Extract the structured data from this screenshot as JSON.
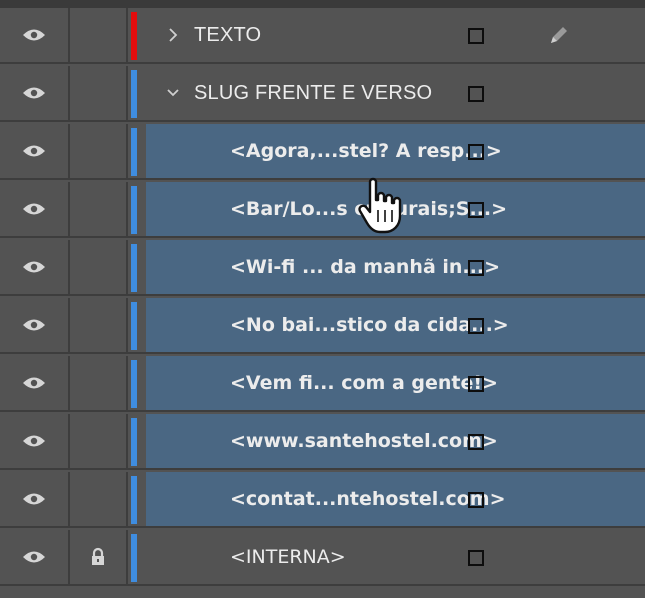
{
  "colors": {
    "panel_bg": "#535353",
    "selected_bg": "#4a6783",
    "layer_color_red": "#e20d0d",
    "layer_color_blue": "#3f8de0",
    "text": "#ececec"
  },
  "layers_panel": {
    "rows": [
      {
        "label": "TEXTO",
        "kind": "layer",
        "expander": "collapsed",
        "visible": true,
        "locked": false,
        "color": "red",
        "selected": false,
        "has_pen": true
      },
      {
        "label": "SLUG FRENTE E VERSO",
        "kind": "layer",
        "expander": "expanded",
        "visible": true,
        "locked": false,
        "color": "blue",
        "selected": false,
        "has_pen": false
      },
      {
        "label": "<Agora,...stel? A resp...>",
        "kind": "item",
        "visible": true,
        "locked": false,
        "color": "blue",
        "selected": true
      },
      {
        "label": "<Bar/Lo...s culturais;S...>",
        "kind": "item",
        "visible": true,
        "locked": false,
        "color": "blue",
        "selected": true
      },
      {
        "label": "<Wi-fi ... da manhã in...>",
        "kind": "item",
        "visible": true,
        "locked": false,
        "color": "blue",
        "selected": true
      },
      {
        "label": "<No bai...stico da cida...>",
        "kind": "item",
        "visible": true,
        "locked": false,
        "color": "blue",
        "selected": true
      },
      {
        "label": "<Vem fi... com a gente!>",
        "kind": "item",
        "visible": true,
        "locked": false,
        "color": "blue",
        "selected": true
      },
      {
        "label": "<www.santehostel.com>",
        "kind": "item",
        "visible": true,
        "locked": false,
        "color": "blue",
        "selected": true
      },
      {
        "label": "<contat...ntehostel.com>",
        "kind": "item",
        "visible": true,
        "locked": false,
        "color": "blue",
        "selected": true
      },
      {
        "label": "<INTERNA>",
        "kind": "plain",
        "visible": true,
        "locked": true,
        "color": "blue",
        "selected": false
      }
    ]
  },
  "icons": {
    "eye": "eye-icon",
    "lock": "lock-icon",
    "pen": "pen-icon",
    "chevron_right": "chevron-right-icon",
    "chevron_down": "chevron-down-icon",
    "cursor": "hand-pointer-cursor-icon"
  }
}
